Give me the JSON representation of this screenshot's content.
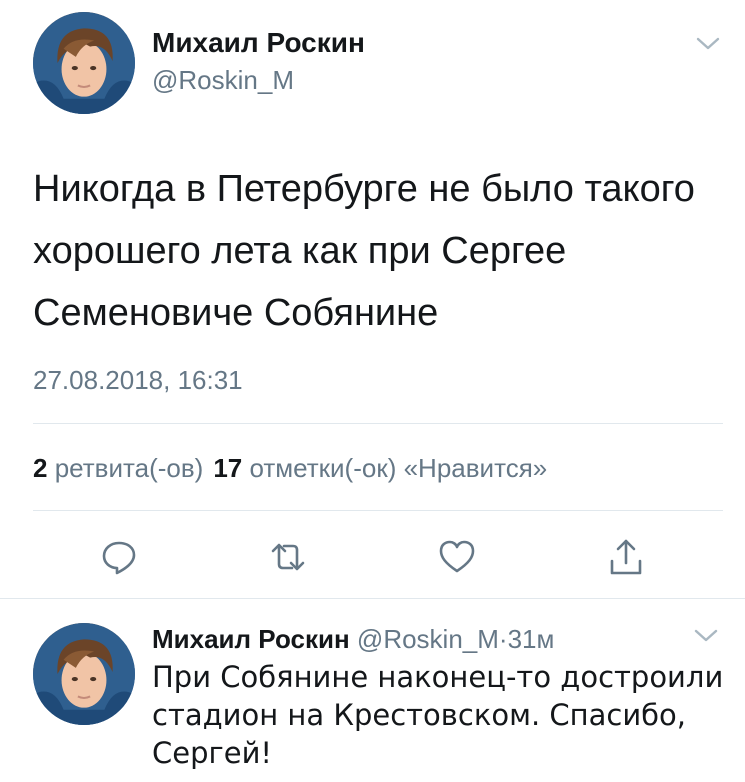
{
  "main_tweet": {
    "author_name": "Михаил Роскин",
    "author_handle": "@Roskin_M",
    "text": "Никогда в Петербурге не было такого хорошего лета как при Сергее Семеновиче Собянине",
    "timestamp": "27.08.2018, 16:31",
    "retweets_count": "2",
    "retweets_label": "ретвита(-ов)",
    "likes_count": "17",
    "likes_label": "отметки(-ок) «Нравится»"
  },
  "actions": [
    {
      "name": "reply",
      "icon": "reply-icon"
    },
    {
      "name": "retweet",
      "icon": "retweet-icon"
    },
    {
      "name": "like",
      "icon": "heart-icon"
    },
    {
      "name": "share",
      "icon": "share-icon"
    }
  ],
  "reply_tweet": {
    "author_name": "Михаил Роскин",
    "author_handle": "@Roskin_M",
    "separator": "·",
    "time_ago": "31м",
    "text": "При Собянине наконец-то достроили стадион на Крестовском. Спасибо, Сергей!"
  },
  "colors": {
    "text": "#14171a",
    "secondary": "#657786",
    "divider": "#e1e8ed"
  }
}
